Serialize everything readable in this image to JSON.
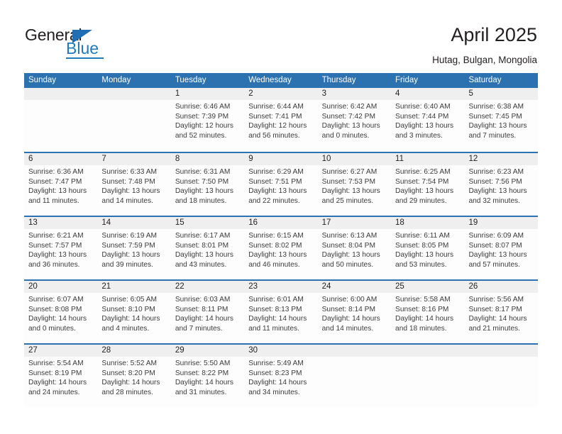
{
  "brand": {
    "name_part1": "General",
    "name_part2": "Blue",
    "triangle_icon": "triangle-icon",
    "accent_color": "#1f7ac0"
  },
  "header": {
    "title": "April 2025",
    "subtitle": "Hutag, Bulgan, Mongolia"
  },
  "calendar": {
    "header_bg": "#2d72b0",
    "daynum_bg": "#efefef",
    "weekdays": [
      "Sunday",
      "Monday",
      "Tuesday",
      "Wednesday",
      "Thursday",
      "Friday",
      "Saturday"
    ],
    "labels": {
      "sunrise": "Sunrise:",
      "sunset": "Sunset:",
      "daylight": "Daylight:"
    },
    "weeks": [
      [
        {
          "day": "",
          "sunrise": "",
          "sunset": "",
          "daylight": ""
        },
        {
          "day": "",
          "sunrise": "",
          "sunset": "",
          "daylight": ""
        },
        {
          "day": "1",
          "sunrise": "Sunrise: 6:46 AM",
          "sunset": "Sunset: 7:39 PM",
          "daylight": "Daylight: 12 hours and 52 minutes."
        },
        {
          "day": "2",
          "sunrise": "Sunrise: 6:44 AM",
          "sunset": "Sunset: 7:41 PM",
          "daylight": "Daylight: 12 hours and 56 minutes."
        },
        {
          "day": "3",
          "sunrise": "Sunrise: 6:42 AM",
          "sunset": "Sunset: 7:42 PM",
          "daylight": "Daylight: 13 hours and 0 minutes."
        },
        {
          "day": "4",
          "sunrise": "Sunrise: 6:40 AM",
          "sunset": "Sunset: 7:44 PM",
          "daylight": "Daylight: 13 hours and 3 minutes."
        },
        {
          "day": "5",
          "sunrise": "Sunrise: 6:38 AM",
          "sunset": "Sunset: 7:45 PM",
          "daylight": "Daylight: 13 hours and 7 minutes."
        }
      ],
      [
        {
          "day": "6",
          "sunrise": "Sunrise: 6:36 AM",
          "sunset": "Sunset: 7:47 PM",
          "daylight": "Daylight: 13 hours and 11 minutes."
        },
        {
          "day": "7",
          "sunrise": "Sunrise: 6:33 AM",
          "sunset": "Sunset: 7:48 PM",
          "daylight": "Daylight: 13 hours and 14 minutes."
        },
        {
          "day": "8",
          "sunrise": "Sunrise: 6:31 AM",
          "sunset": "Sunset: 7:50 PM",
          "daylight": "Daylight: 13 hours and 18 minutes."
        },
        {
          "day": "9",
          "sunrise": "Sunrise: 6:29 AM",
          "sunset": "Sunset: 7:51 PM",
          "daylight": "Daylight: 13 hours and 22 minutes."
        },
        {
          "day": "10",
          "sunrise": "Sunrise: 6:27 AM",
          "sunset": "Sunset: 7:53 PM",
          "daylight": "Daylight: 13 hours and 25 minutes."
        },
        {
          "day": "11",
          "sunrise": "Sunrise: 6:25 AM",
          "sunset": "Sunset: 7:54 PM",
          "daylight": "Daylight: 13 hours and 29 minutes."
        },
        {
          "day": "12",
          "sunrise": "Sunrise: 6:23 AM",
          "sunset": "Sunset: 7:56 PM",
          "daylight": "Daylight: 13 hours and 32 minutes."
        }
      ],
      [
        {
          "day": "13",
          "sunrise": "Sunrise: 6:21 AM",
          "sunset": "Sunset: 7:57 PM",
          "daylight": "Daylight: 13 hours and 36 minutes."
        },
        {
          "day": "14",
          "sunrise": "Sunrise: 6:19 AM",
          "sunset": "Sunset: 7:59 PM",
          "daylight": "Daylight: 13 hours and 39 minutes."
        },
        {
          "day": "15",
          "sunrise": "Sunrise: 6:17 AM",
          "sunset": "Sunset: 8:01 PM",
          "daylight": "Daylight: 13 hours and 43 minutes."
        },
        {
          "day": "16",
          "sunrise": "Sunrise: 6:15 AM",
          "sunset": "Sunset: 8:02 PM",
          "daylight": "Daylight: 13 hours and 46 minutes."
        },
        {
          "day": "17",
          "sunrise": "Sunrise: 6:13 AM",
          "sunset": "Sunset: 8:04 PM",
          "daylight": "Daylight: 13 hours and 50 minutes."
        },
        {
          "day": "18",
          "sunrise": "Sunrise: 6:11 AM",
          "sunset": "Sunset: 8:05 PM",
          "daylight": "Daylight: 13 hours and 53 minutes."
        },
        {
          "day": "19",
          "sunrise": "Sunrise: 6:09 AM",
          "sunset": "Sunset: 8:07 PM",
          "daylight": "Daylight: 13 hours and 57 minutes."
        }
      ],
      [
        {
          "day": "20",
          "sunrise": "Sunrise: 6:07 AM",
          "sunset": "Sunset: 8:08 PM",
          "daylight": "Daylight: 14 hours and 0 minutes."
        },
        {
          "day": "21",
          "sunrise": "Sunrise: 6:05 AM",
          "sunset": "Sunset: 8:10 PM",
          "daylight": "Daylight: 14 hours and 4 minutes."
        },
        {
          "day": "22",
          "sunrise": "Sunrise: 6:03 AM",
          "sunset": "Sunset: 8:11 PM",
          "daylight": "Daylight: 14 hours and 7 minutes."
        },
        {
          "day": "23",
          "sunrise": "Sunrise: 6:01 AM",
          "sunset": "Sunset: 8:13 PM",
          "daylight": "Daylight: 14 hours and 11 minutes."
        },
        {
          "day": "24",
          "sunrise": "Sunrise: 6:00 AM",
          "sunset": "Sunset: 8:14 PM",
          "daylight": "Daylight: 14 hours and 14 minutes."
        },
        {
          "day": "25",
          "sunrise": "Sunrise: 5:58 AM",
          "sunset": "Sunset: 8:16 PM",
          "daylight": "Daylight: 14 hours and 18 minutes."
        },
        {
          "day": "26",
          "sunrise": "Sunrise: 5:56 AM",
          "sunset": "Sunset: 8:17 PM",
          "daylight": "Daylight: 14 hours and 21 minutes."
        }
      ],
      [
        {
          "day": "27",
          "sunrise": "Sunrise: 5:54 AM",
          "sunset": "Sunset: 8:19 PM",
          "daylight": "Daylight: 14 hours and 24 minutes."
        },
        {
          "day": "28",
          "sunrise": "Sunrise: 5:52 AM",
          "sunset": "Sunset: 8:20 PM",
          "daylight": "Daylight: 14 hours and 28 minutes."
        },
        {
          "day": "29",
          "sunrise": "Sunrise: 5:50 AM",
          "sunset": "Sunset: 8:22 PM",
          "daylight": "Daylight: 14 hours and 31 minutes."
        },
        {
          "day": "30",
          "sunrise": "Sunrise: 5:49 AM",
          "sunset": "Sunset: 8:23 PM",
          "daylight": "Daylight: 14 hours and 34 minutes."
        },
        {
          "day": "",
          "sunrise": "",
          "sunset": "",
          "daylight": ""
        },
        {
          "day": "",
          "sunrise": "",
          "sunset": "",
          "daylight": ""
        },
        {
          "day": "",
          "sunrise": "",
          "sunset": "",
          "daylight": ""
        }
      ]
    ]
  }
}
